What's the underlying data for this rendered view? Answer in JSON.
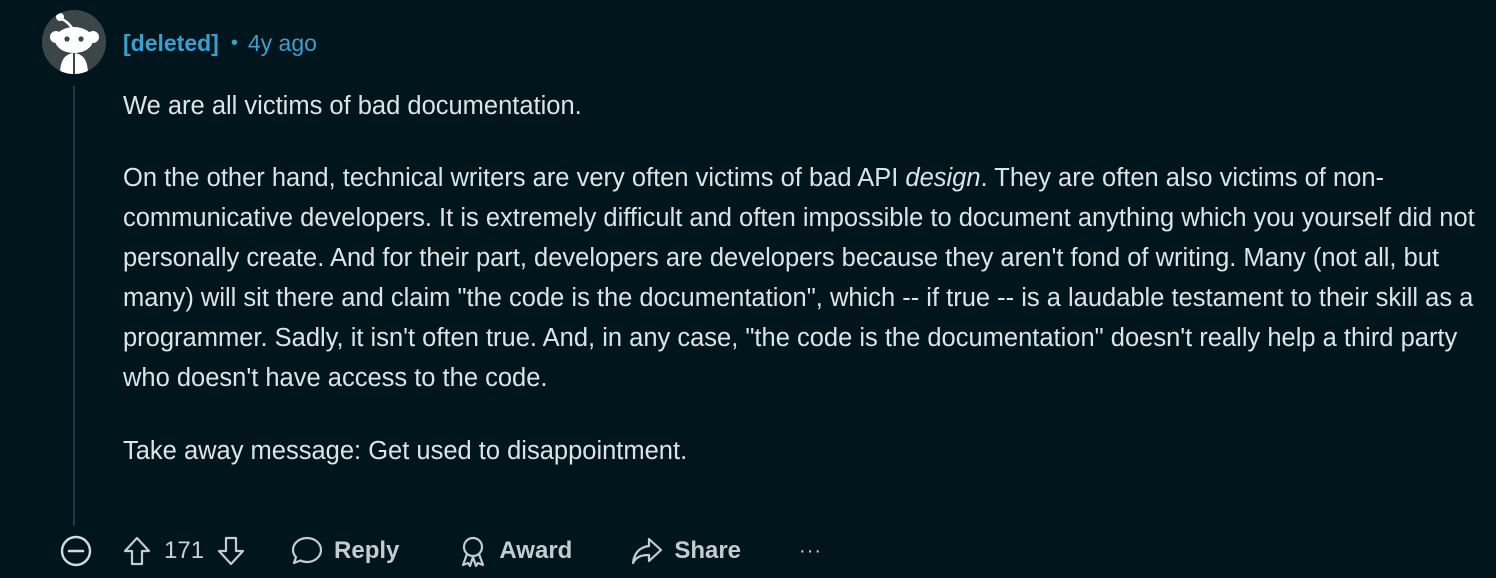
{
  "comment": {
    "author": "[deleted]",
    "separator": "•",
    "time": "4y ago",
    "body": {
      "p1": "We are all victims of bad documentation.",
      "p2_before": "On the other hand, technical writers are very often victims of bad API ",
      "p2_em": "design",
      "p2_after": ". They are often also victims of non-communicative developers. It is extremely difficult and often impossible to document anything which you yourself did not personally create. And for their part, developers are developers because they aren't fond of writing. Many (not all, but many) will sit there and claim \"the code is the documentation\", which -- if true -- is a laudable testament to their skill as a programmer. Sadly, it isn't often true. And, in any case, \"the code is the documentation\" doesn't really help a third party who doesn't have access to the code.",
      "p3": "Take away message: Get used to disappointment."
    }
  },
  "actions": {
    "score": "171",
    "reply_label": "Reply",
    "award_label": "Award",
    "share_label": "Share",
    "more_label": "···"
  },
  "icons": {
    "collapse": "minus-circle-icon",
    "upvote": "arrow-up-icon",
    "downvote": "arrow-down-icon",
    "reply": "speech-bubble-icon",
    "award": "award-ribbon-icon",
    "share": "share-arrow-icon"
  },
  "colors": {
    "background": "#01161c",
    "username": "#3a9fcf",
    "text": "#dde3e6",
    "thread_line": "#1f3b47"
  }
}
